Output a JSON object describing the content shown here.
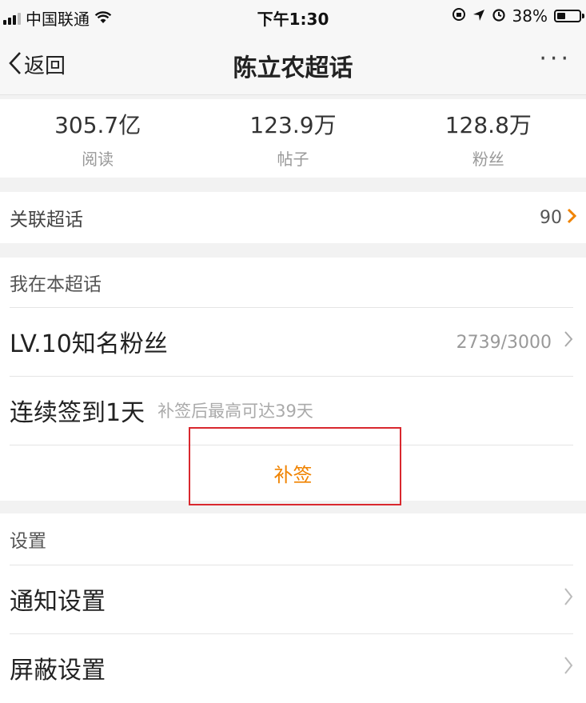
{
  "status_bar": {
    "carrier": "中国联通",
    "time": "下午1:30",
    "battery": "38%",
    "battery_level": 0.38
  },
  "nav": {
    "back_label": "返回",
    "title": "陈立农超话",
    "more_label": "···"
  },
  "stats": [
    {
      "value": "305.7亿",
      "label": "阅读"
    },
    {
      "value": "123.9万",
      "label": "帖子"
    },
    {
      "value": "128.8万",
      "label": "粉丝"
    }
  ],
  "related": {
    "label": "关联超话",
    "count": "90"
  },
  "my_section": {
    "header": "我在本超话",
    "level_name": "LV.10知名粉丝",
    "level_progress": "2739/3000",
    "streak_main": "连续签到1天",
    "streak_sub": "补签后最高可达39天",
    "makeup_label": "补签"
  },
  "settings": {
    "header": "设置",
    "items": [
      {
        "label": "通知设置"
      },
      {
        "label": "屏蔽设置"
      }
    ]
  },
  "colors": {
    "accent": "#f08300",
    "highlight_box": "#d9282e"
  }
}
